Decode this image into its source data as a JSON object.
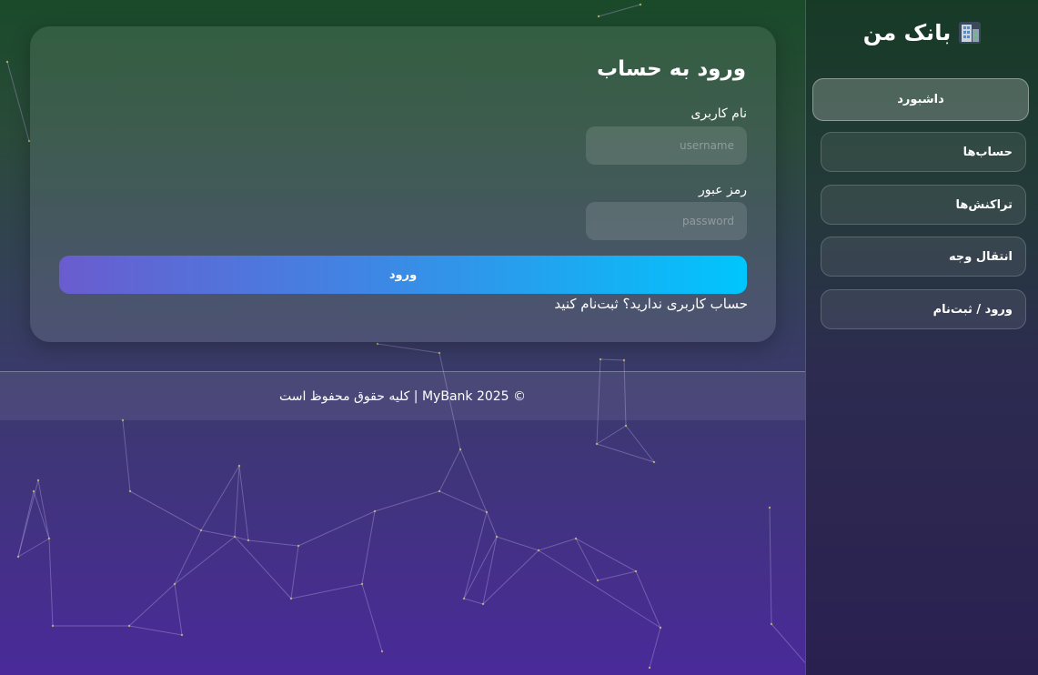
{
  "sidebar": {
    "brand": "بانک من",
    "brand_icon": "bank-building-icon",
    "items": [
      {
        "label": "داشبورد",
        "active": true
      },
      {
        "label": "حساب‌ها",
        "active": false
      },
      {
        "label": "تراکنش‌ها",
        "active": false
      },
      {
        "label": "انتقال وجه",
        "active": false
      },
      {
        "label": "ورود / ثبت‌نام",
        "active": false
      }
    ]
  },
  "login": {
    "title": "ورود به حساب",
    "username_label": "نام کاربری",
    "username_placeholder": "username",
    "password_label": "رمز عبور",
    "password_placeholder": "password",
    "submit_label": "ورود",
    "register_text": "حساب کاربری ندارید؟ ثبت‌نام کنید"
  },
  "footer": {
    "text": "© 2025 MyBank | کلیه حقوق محفوظ است"
  },
  "colors": {
    "button_gradient_start": "#6a5ccf",
    "button_gradient_end": "#00c6fd",
    "background_top": "#1a4a2a",
    "background_bottom": "#4a2a9a",
    "network_line": "#a89ad8"
  }
}
